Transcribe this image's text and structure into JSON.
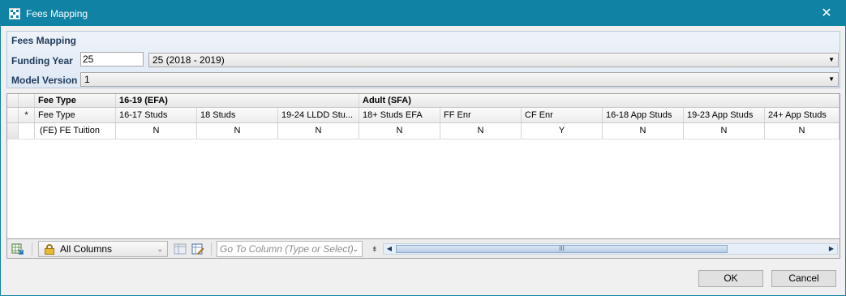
{
  "window": {
    "title": "Fees Mapping",
    "close_glyph": "✕"
  },
  "panel": {
    "title": "Fees Mapping",
    "funding_year": {
      "label": "Funding Year",
      "value": "25",
      "selected": "25 (2018 - 2019)"
    },
    "model_version": {
      "label": "Model Version",
      "selected": "1"
    }
  },
  "grid": {
    "band_headers": [
      "Fee Type",
      "16-19 (EFA)",
      "Adult (SFA)"
    ],
    "filter_row_marker": "*",
    "columns": [
      "Fee Type",
      "16-17 Studs",
      "18 Studs",
      "19-24 LLDD Stu...",
      "18+ Studs EFA",
      "FF Enr",
      "CF Enr",
      "16-18 App Studs",
      "19-23 App Studs",
      "24+ App Studs"
    ],
    "rows": [
      {
        "fee_type": "(FE) FE Tuition",
        "values": [
          "N",
          "N",
          "N",
          "N",
          "N",
          "Y",
          "N",
          "N",
          "N"
        ]
      }
    ]
  },
  "footer": {
    "column_chooser": "All Columns",
    "goto_placeholder": "Go To Column (Type or Select)",
    "scroll_thumb_glyph": "III"
  },
  "buttons": {
    "ok": "OK",
    "cancel": "Cancel"
  },
  "colors": {
    "titlebar": "#1083a5",
    "panel_label": "#1e395b"
  }
}
